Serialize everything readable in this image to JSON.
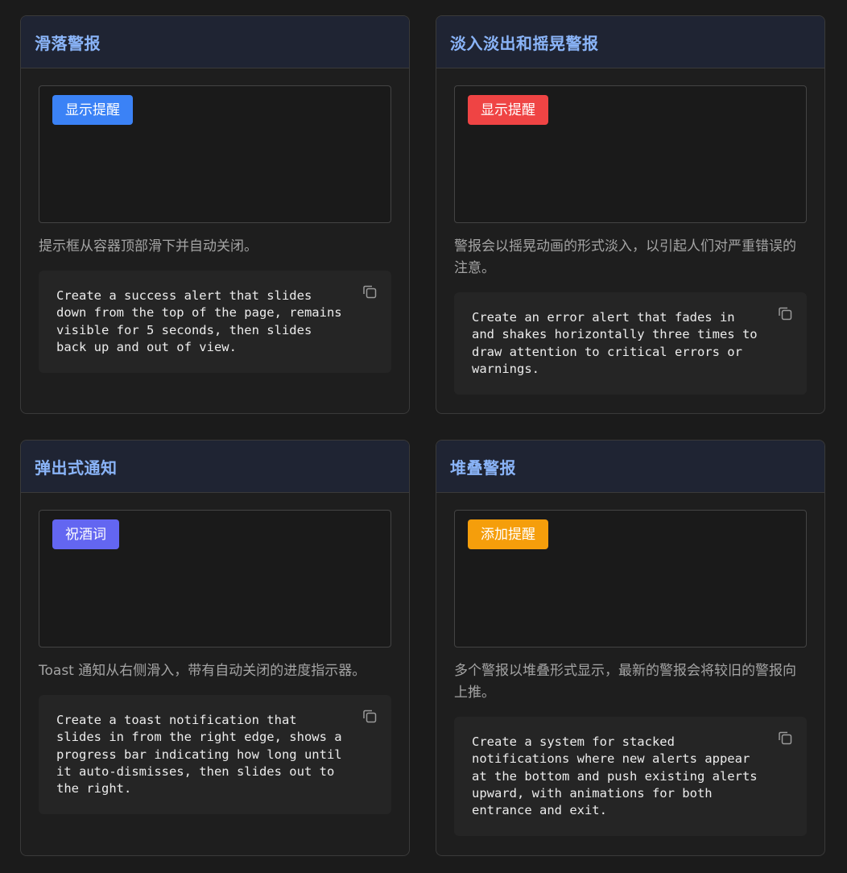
{
  "cards": [
    {
      "title": "滑落警报",
      "button_label": "显示提醒",
      "button_color": "#3b82f6",
      "description": "提示框从容器顶部滑下并自动关闭。",
      "prompt": "Create a success alert that slides\ndown from the top of the page, remains\nvisible for 5 seconds, then slides\nback up and out of view."
    },
    {
      "title": "淡入淡出和摇晃警报",
      "button_label": "显示提醒",
      "button_color": "#ef4444",
      "description": "警报会以摇晃动画的形式淡入，以引起人们对严重错误的注意。",
      "prompt": "Create an error alert that fades in\nand shakes horizontally three times to\ndraw attention to critical errors or\nwarnings."
    },
    {
      "title": "弹出式通知",
      "button_label": "祝酒词",
      "button_color": "#6366f1",
      "description": "Toast 通知从右侧滑入，带有自动关闭的进度指示器。",
      "prompt": "Create a toast notification that\nslides in from the right edge, shows a\nprogress bar indicating how long until\nit auto-dismisses, then slides out to\nthe right."
    },
    {
      "title": "堆叠警报",
      "button_label": "添加提醒",
      "button_color": "#f59e0b",
      "description": "多个警报以堆叠形式显示，最新的警报会将较旧的警报向上推。",
      "prompt": "Create a system for stacked\nnotifications where new alerts appear\nat the bottom and push existing alerts\nupward, with animations for both\nentrance and exit."
    }
  ],
  "icons": {
    "copy": "copy-icon"
  }
}
